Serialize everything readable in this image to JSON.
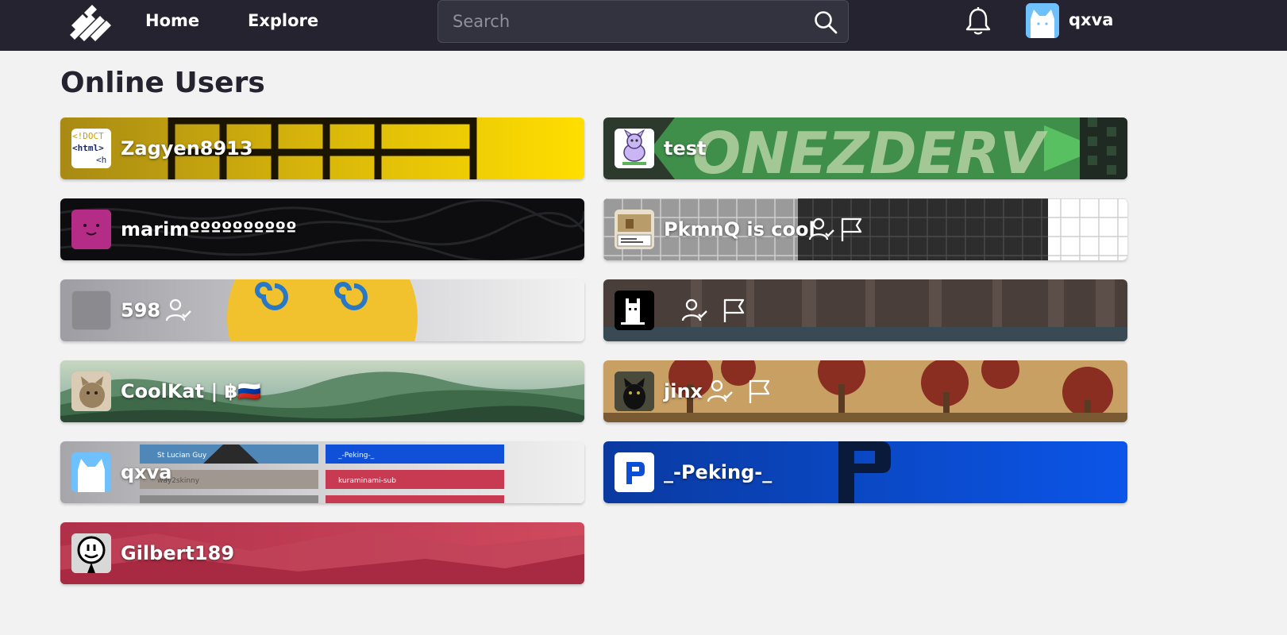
{
  "header": {
    "nav_home": "Home",
    "nav_explore": "Explore",
    "search_placeholder": "Search",
    "username": "qxva"
  },
  "page": {
    "title": "Online Users"
  },
  "users": [
    {
      "name": "Zagyen8913",
      "avatar_text": [
        "<!DOCT",
        "<html>",
        "<h"
      ]
    },
    {
      "name": "test",
      "banner_text": "ONEZDERV"
    },
    {
      "name": "marimºººººººººº"
    },
    {
      "name": "PkmnQ is cool"
    },
    {
      "name": "598"
    },
    {
      "name": ""
    },
    {
      "name": "CoolKat | ฿🇷🇺"
    },
    {
      "name": "jinx"
    },
    {
      "name": "qxva",
      "banner_labels": [
        "St Lucian Guy",
        "_-Peking-_",
        "way2skinny",
        "kuraminami-sub"
      ]
    },
    {
      "name": "_-Peking-_"
    },
    {
      "name": "Gilbert189"
    }
  ],
  "icons": [
    "logo-icon",
    "search-icon",
    "bell-icon",
    "follow-user-icon",
    "report-flag-icon"
  ],
  "colors": {
    "topbar": "#24232f",
    "background": "#f2f2f2",
    "peking_blue": "#0b4fd9",
    "gilbert_red": "#c73a52"
  }
}
